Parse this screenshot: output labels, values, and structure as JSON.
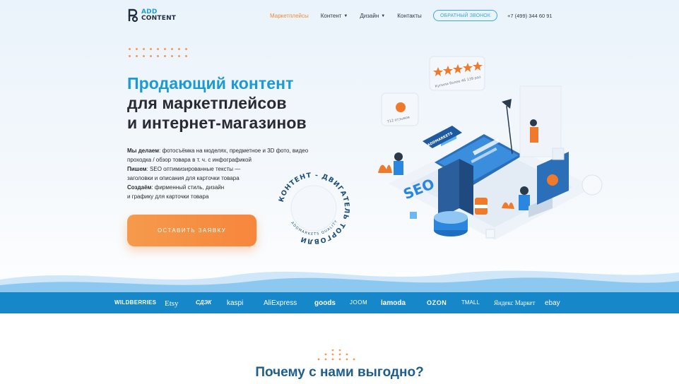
{
  "header": {
    "logo": {
      "line1": "ADD",
      "line2": "CONTENT"
    },
    "nav": [
      {
        "label": "Маркетплейсы",
        "active": true,
        "dropdown": false
      },
      {
        "label": "Контент",
        "active": false,
        "dropdown": true
      },
      {
        "label": "Дизайн",
        "active": false,
        "dropdown": true
      },
      {
        "label": "Контакты",
        "active": false,
        "dropdown": false
      }
    ],
    "callback_label": "ОБРАТНЫЙ ЗВОНОК",
    "phone": "+7 (499) 344 60 91"
  },
  "hero": {
    "title_accent": "Продающий контент",
    "title_line2": "для маркетплейсов",
    "title_line3": "и интернет-магазинов",
    "desc": [
      {
        "bold": "Мы делаем",
        "text": ": фотосъёмка на моделях, предметное и 3D фото, видео"
      },
      {
        "bold": "",
        "text": "проходка / обзор товара в т. ч. с инфографикой"
      },
      {
        "bold": "Пишем",
        "text": ": SEO оптимизированные тексты —"
      },
      {
        "bold": "",
        "text": "заголовки и описания для карточки товара"
      },
      {
        "bold": "Создаём",
        "text": ": фирменный стиль, дизайн"
      },
      {
        "bold": "",
        "text": "и графику для карточки товара"
      }
    ],
    "cta_label": "ОСТАВИТЬ ЗАЯВКУ",
    "badge_text": "КОНТЕНТ - ДВИГАТЕЛЬ ТОРГОВЛИ",
    "badge_subtext": "ADDMARKETS QUALITY",
    "illustration": {
      "reviews_label": "712 отзывов",
      "bought_label": "Купили более 46 139 раз",
      "seo_label": "SEO",
      "brand_label": "ADDMARKETS"
    }
  },
  "marketplaces": [
    "WILDBERRIES",
    "Etsy",
    "СДЭК",
    "kaspi",
    "AliExpress",
    "goods",
    "JOOM",
    "lamoda",
    "OZON",
    "TMALL",
    "Яндекс Маркет",
    "ebay"
  ],
  "section": {
    "title": "Почему с нами выгодно?"
  },
  "colors": {
    "accent_blue": "#1b9ad6",
    "accent_orange": "#f7863b",
    "wave_blue": "#1687c8"
  }
}
